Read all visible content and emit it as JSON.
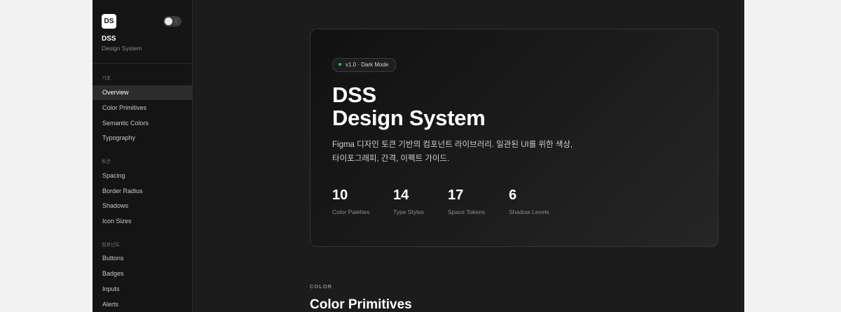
{
  "sidebar": {
    "logo": "DS",
    "title": "DSS",
    "subtitle": "Design System",
    "theme_toggle_icon": "moon-icon",
    "sections": [
      {
        "label": "기초",
        "items": [
          "Overview",
          "Color Primitives",
          "Semantic Colors",
          "Typography"
        ]
      },
      {
        "label": "토큰",
        "items": [
          "Spacing",
          "Border Radius",
          "Shadows",
          "Icon Sizes"
        ]
      },
      {
        "label": "컴포넌트",
        "items": [
          "Buttons",
          "Badges",
          "Inputs",
          "Alerts"
        ]
      }
    ],
    "active_item": "Overview"
  },
  "hero": {
    "badge": "v1.0 · Dark Mode",
    "title_line1": "DSS",
    "title_line2": "Design System",
    "desc_line1": "Figma 디자인 토큰 기반의 컴포넌트 라이브러리. 일관된 UI를 위한 색상,",
    "desc_line2": "타이포그래피, 간격, 이펙트 가이드.",
    "stats": [
      {
        "value": "10",
        "label": "Color Palettes"
      },
      {
        "value": "14",
        "label": "Type Styles"
      },
      {
        "value": "17",
        "label": "Space Tokens"
      },
      {
        "value": "6",
        "label": "Shadow Levels"
      }
    ]
  },
  "section": {
    "eyebrow": "COLOR",
    "title": "Color Primitives"
  },
  "colors": {
    "background": "#1c1c1c",
    "sidebar": "#141414",
    "accent_dot": "#22c55e"
  }
}
